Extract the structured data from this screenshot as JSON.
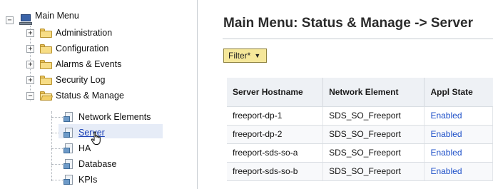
{
  "tree": {
    "root_label": "Main Menu",
    "items": [
      {
        "label": "Administration",
        "toggle": "+"
      },
      {
        "label": "Configuration",
        "toggle": "+"
      },
      {
        "label": "Alarms & Events",
        "toggle": "+"
      },
      {
        "label": "Security Log",
        "toggle": "+"
      },
      {
        "label": "Status & Manage",
        "toggle": "−"
      }
    ],
    "children": [
      {
        "label": "Network Elements"
      },
      {
        "label": "Server"
      },
      {
        "label": "HA"
      },
      {
        "label": "Database"
      },
      {
        "label": "KPIs"
      }
    ],
    "root_toggle": "−",
    "selected": "Server"
  },
  "main": {
    "title": "Main Menu: Status & Manage -> Server",
    "filter_label": "Filter*",
    "table": {
      "headers": [
        "Server Hostname",
        "Network Element",
        "Appl State"
      ],
      "rows": [
        [
          "freeport-dp-1",
          "SDS_SO_Freeport",
          "Enabled"
        ],
        [
          "freeport-dp-2",
          "SDS_SO_Freeport",
          "Enabled"
        ],
        [
          "freeport-sds-so-a",
          "SDS_SO_Freeport",
          "Enabled"
        ],
        [
          "freeport-sds-so-b",
          "SDS_SO_Freeport",
          "Enabled"
        ]
      ]
    }
  },
  "colors": {
    "filter_bg": "#f5e79a",
    "status_link": "#1e50c8",
    "selected_link": "#1a3fb5"
  }
}
